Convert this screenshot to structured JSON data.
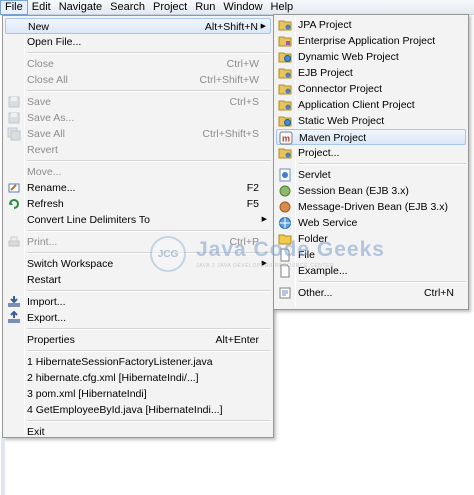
{
  "menubar": {
    "items": [
      "File",
      "Edit",
      "Navigate",
      "Search",
      "Project",
      "Run",
      "Window",
      "Help"
    ],
    "active_index": 0
  },
  "file_menu": {
    "items": [
      {
        "label": "New",
        "shortcut": "Alt+Shift+N",
        "submenu": true,
        "highlighted": true,
        "icon": "none"
      },
      {
        "label": "Open File...",
        "shortcut": "",
        "icon": "none"
      },
      {
        "sep": true
      },
      {
        "label": "Close",
        "shortcut": "Ctrl+W",
        "disabled": true,
        "icon": "none"
      },
      {
        "label": "Close All",
        "shortcut": "Ctrl+Shift+W",
        "disabled": true,
        "icon": "none"
      },
      {
        "sep": true
      },
      {
        "label": "Save",
        "shortcut": "Ctrl+S",
        "disabled": true,
        "icon": "save-icon"
      },
      {
        "label": "Save As...",
        "shortcut": "",
        "disabled": true,
        "icon": "save-as-icon"
      },
      {
        "label": "Save All",
        "shortcut": "Ctrl+Shift+S",
        "disabled": true,
        "icon": "save-all-icon"
      },
      {
        "label": "Revert",
        "shortcut": "",
        "disabled": true,
        "icon": "none"
      },
      {
        "sep": true
      },
      {
        "label": "Move...",
        "shortcut": "",
        "disabled": true,
        "icon": "none"
      },
      {
        "label": "Rename...",
        "shortcut": "F2",
        "icon": "rename-icon"
      },
      {
        "label": "Refresh",
        "shortcut": "F5",
        "icon": "refresh-icon"
      },
      {
        "label": "Convert Line Delimiters To",
        "shortcut": "",
        "submenu": true,
        "icon": "none"
      },
      {
        "sep": true
      },
      {
        "label": "Print...",
        "shortcut": "Ctrl+P",
        "disabled": true,
        "icon": "print-icon"
      },
      {
        "sep": true
      },
      {
        "label": "Switch Workspace",
        "shortcut": "",
        "submenu": true,
        "icon": "none"
      },
      {
        "label": "Restart",
        "shortcut": "",
        "icon": "none"
      },
      {
        "sep": true
      },
      {
        "label": "Import...",
        "shortcut": "",
        "icon": "import-icon"
      },
      {
        "label": "Export...",
        "shortcut": "",
        "icon": "export-icon"
      },
      {
        "sep": true
      },
      {
        "label": "Properties",
        "shortcut": "Alt+Enter",
        "icon": "none"
      },
      {
        "sep": true
      },
      {
        "label": "1 HibernateSessionFactoryListener.java",
        "shortcut": "",
        "icon": "none"
      },
      {
        "label": "2 hibernate.cfg.xml  [HibernateIndi/...]",
        "shortcut": "",
        "icon": "none"
      },
      {
        "label": "3 pom.xml  [HibernateIndi]",
        "shortcut": "",
        "icon": "none"
      },
      {
        "label": "4 GetEmployeeById.java  [HibernateIndi...]",
        "shortcut": "",
        "icon": "none"
      },
      {
        "sep": true
      },
      {
        "label": "Exit",
        "shortcut": "",
        "icon": "none"
      }
    ]
  },
  "new_submenu": {
    "items": [
      {
        "label": "JPA Project",
        "shortcut": "",
        "icon": "jpa-project-icon"
      },
      {
        "label": "Enterprise Application Project",
        "shortcut": "",
        "icon": "ear-project-icon"
      },
      {
        "label": "Dynamic Web Project",
        "shortcut": "",
        "icon": "web-project-icon"
      },
      {
        "label": "EJB Project",
        "shortcut": "",
        "icon": "ejb-project-icon"
      },
      {
        "label": "Connector Project",
        "shortcut": "",
        "icon": "connector-project-icon"
      },
      {
        "label": "Application Client Project",
        "shortcut": "",
        "icon": "app-client-project-icon"
      },
      {
        "label": "Static Web Project",
        "shortcut": "",
        "icon": "static-web-project-icon"
      },
      {
        "label": "Maven Project",
        "shortcut": "",
        "icon": "maven-project-icon",
        "highlighted": true
      },
      {
        "label": "Project...",
        "shortcut": "",
        "icon": "project-icon"
      },
      {
        "sep": true
      },
      {
        "label": "Servlet",
        "shortcut": "",
        "icon": "servlet-icon"
      },
      {
        "label": "Session Bean (EJB 3.x)",
        "shortcut": "",
        "icon": "session-bean-icon"
      },
      {
        "label": "Message-Driven Bean (EJB 3.x)",
        "shortcut": "",
        "icon": "mdb-icon"
      },
      {
        "label": "Web Service",
        "shortcut": "",
        "icon": "web-service-icon"
      },
      {
        "label": "Folder",
        "shortcut": "",
        "icon": "folder-icon"
      },
      {
        "label": "File",
        "shortcut": "",
        "icon": "file-icon"
      },
      {
        "label": "Example...",
        "shortcut": "",
        "icon": "example-icon"
      },
      {
        "sep": true
      },
      {
        "label": "Other...",
        "shortcut": "Ctrl+N",
        "icon": "other-icon"
      }
    ]
  },
  "watermark": {
    "logo_text": "JCG",
    "name": "Java Code Geeks",
    "tagline": "JAVA 2 JAVA DEVELOPERS RESOURCE CENTER"
  },
  "colors": {
    "menu_bg": "#f3f3f3",
    "highlight_border": "#a8c6ea",
    "disabled_text": "#8d8d8d",
    "watermark_blue": "#7ea0cc"
  }
}
